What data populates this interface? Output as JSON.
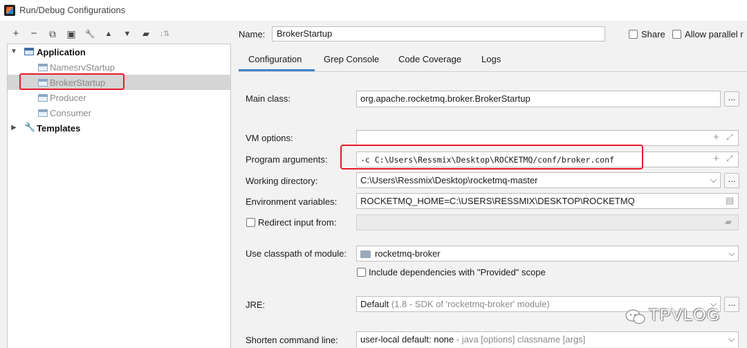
{
  "window": {
    "title": "Run/Debug Configurations"
  },
  "toolbar": {
    "icons": [
      "plus-icon",
      "minus-icon",
      "copy-icon",
      "save-icon",
      "wrench-icon",
      "arrow-up-icon",
      "arrow-down-icon",
      "folder-move-icon",
      "sort-icon"
    ],
    "glyphs": [
      "+",
      "−",
      "⧉",
      "▣",
      "🔧",
      "▲",
      "▼",
      "▰",
      "↓⇅"
    ]
  },
  "tree": {
    "application_label": "Application",
    "items": [
      {
        "label": "NamesrvStartup"
      },
      {
        "label": "BrokerStartup"
      },
      {
        "label": "Producer"
      },
      {
        "label": "Consumer"
      }
    ],
    "templates_label": "Templates"
  },
  "header": {
    "name_label": "Name:",
    "name_value": "BrokerStartup",
    "share_label": "Share",
    "allow_parallel_label": "Allow parallel r"
  },
  "tabs": [
    {
      "label": "Configuration"
    },
    {
      "label": "Grep Console"
    },
    {
      "label": "Code Coverage"
    },
    {
      "label": "Logs"
    }
  ],
  "form": {
    "main_class_label": "Main class:",
    "main_class_value": "org.apache.rocketmq.broker.BrokerStartup",
    "vm_options_label": "VM options:",
    "vm_options_value": "",
    "program_args_label": "Program arguments:",
    "program_args_value": "-c C:\\Users\\Ressmix\\Desktop\\ROCKETMQ/conf/broker.conf",
    "working_dir_label": "Working directory:",
    "working_dir_value": "C:\\Users\\Ressmix\\Desktop\\rocketmq-master",
    "env_vars_label": "Environment variables:",
    "env_vars_value": "ROCKETMQ_HOME=C:\\USERS\\RESSMIX\\DESKTOP\\ROCKETMQ",
    "redirect_label": "Redirect input from:",
    "classpath_label": "Use classpath of module:",
    "classpath_value": "rocketmq-broker",
    "include_deps_label": "Include dependencies with \"Provided\" scope",
    "jre_label": "JRE:",
    "jre_value": "Default",
    "jre_hint": "(1.8 - SDK of 'rocketmq-broker' module)",
    "shorten_label": "Shorten command line:",
    "shorten_value": "user-local default: none",
    "shorten_hint": "- java [options] classname [args]",
    "browse_label": "..."
  },
  "watermark": "TPVLOG",
  "colors": {
    "highlight_red": "#e8182b",
    "tab_accent": "#4083c9",
    "selection": "#d5d5d5"
  }
}
